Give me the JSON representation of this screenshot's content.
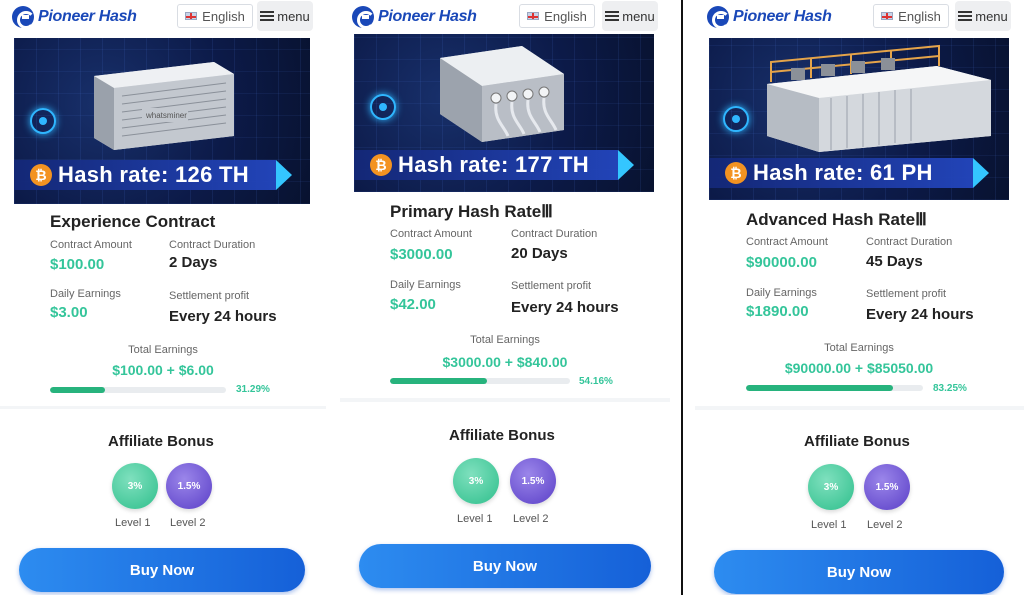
{
  "brand": {
    "name": "Pioneer Hash",
    "color": "#1a48b8"
  },
  "header": {
    "language": "English",
    "menu_label": "menu"
  },
  "accent": {
    "green": "#34c59a",
    "purple": "#5a3fc7",
    "button_blue": "#1f74e6",
    "btc_orange": "#f39321"
  },
  "common": {
    "labels": {
      "amount": "Contract Amount",
      "duration": "Contract Duration",
      "daily": "Daily Earnings",
      "settlement": "Settlement profit",
      "total": "Total Earnings"
    },
    "affiliate_title": "Affiliate Bonus",
    "buy_label": "Buy Now"
  },
  "panels": [
    {
      "hash_rate": "Hash rate: 126 TH",
      "machine_brand": "whatsminer",
      "title": "Experience Contract",
      "amount": "$100.00",
      "duration": "2 Days",
      "daily": "$3.00",
      "settlement": "Every 24 hours",
      "total": "$100.00 + $6.00",
      "progress_pct": 31.29,
      "progress_label": "31.29%",
      "levels": [
        {
          "value": "3%",
          "label": "Level 1"
        },
        {
          "value": "1.5%",
          "label": "Level 2"
        }
      ]
    },
    {
      "hash_rate": "Hash rate: 177 TH",
      "title": "Primary Hash RateⅢ",
      "amount": "$3000.00",
      "duration": "20 Days",
      "daily": "$42.00",
      "settlement": "Every 24 hours",
      "total": "$3000.00 + $840.00",
      "progress_pct": 54.16,
      "progress_label": "54.16%",
      "levels": [
        {
          "value": "3%",
          "label": "Level 1"
        },
        {
          "value": "1.5%",
          "label": "Level 2"
        }
      ]
    },
    {
      "hash_rate": "Hash rate: 61 PH",
      "title": "Advanced Hash RateⅢ",
      "amount": "$90000.00",
      "duration": "45 Days",
      "daily": "$1890.00",
      "settlement": "Every 24 hours",
      "total": "$90000.00 + $85050.00",
      "progress_pct": 83.25,
      "progress_label": "83.25%",
      "levels": [
        {
          "value": "3%",
          "label": "Level 1"
        },
        {
          "value": "1.5%",
          "label": "Level 2"
        }
      ]
    }
  ]
}
